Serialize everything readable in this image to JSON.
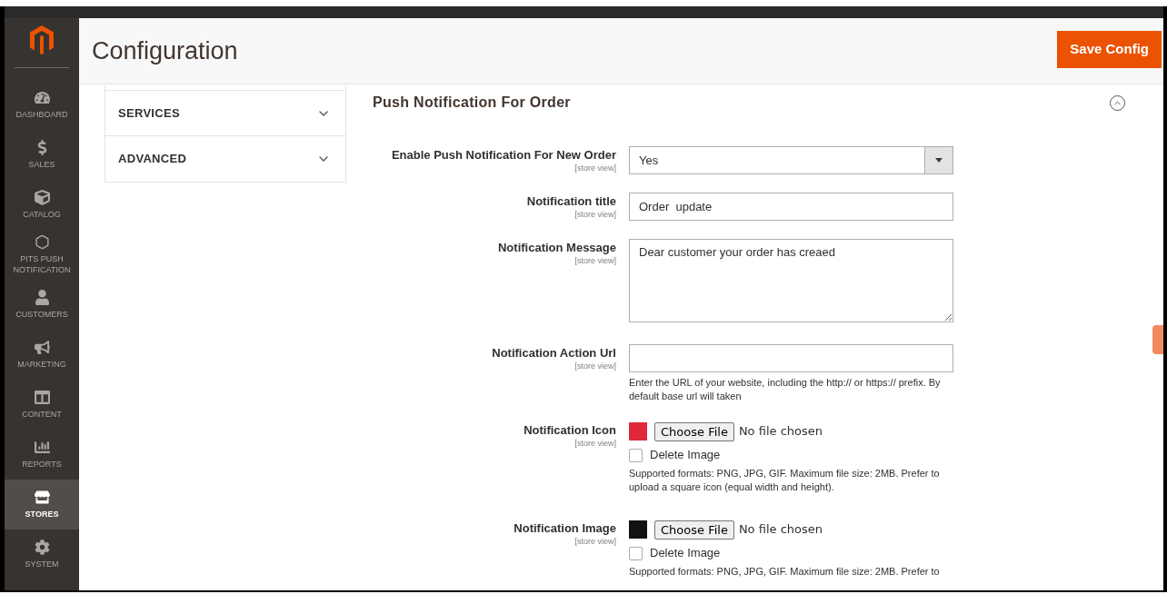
{
  "header": {
    "title": "Configuration",
    "save_button": "Save Config"
  },
  "sidebar": {
    "items": [
      {
        "label": "DASHBOARD",
        "selected": false
      },
      {
        "label": "SALES",
        "selected": false
      },
      {
        "label": "CATALOG",
        "selected": false
      },
      {
        "label": "PITS PUSH NOTIFICATION",
        "selected": false
      },
      {
        "label": "CUSTOMERS",
        "selected": false
      },
      {
        "label": "MARKETING",
        "selected": false
      },
      {
        "label": "CONTENT",
        "selected": false
      },
      {
        "label": "REPORTS",
        "selected": false
      },
      {
        "label": "STORES",
        "selected": true
      },
      {
        "label": "SYSTEM",
        "selected": false
      }
    ]
  },
  "config_tabs": [
    {
      "label": "SERVICES",
      "expanded": false
    },
    {
      "label": "ADVANCED",
      "expanded": false
    }
  ],
  "section": {
    "title": "Push Notification For Order",
    "expanded": true,
    "fields": [
      {
        "kind": "select",
        "label": "Enable Push Notification For New Order",
        "scope": "[store view]",
        "value": "Yes"
      },
      {
        "kind": "text",
        "label": "Notification title",
        "scope": "[store view]",
        "value": "Order  update"
      },
      {
        "kind": "textarea",
        "label": "Notification Message",
        "scope": "[store view]",
        "value": "Dear customer your order has creaed"
      },
      {
        "kind": "text",
        "label": "Notification Action Url",
        "scope": "[store view]",
        "hint": "Enter the URL of your website, including the http:// or https:// prefix. By default base url will taken"
      },
      {
        "kind": "file",
        "label": "Notification Icon",
        "scope": "[store view]",
        "button": "Choose File",
        "status": "No file chosen",
        "delete_label": "Delete Image",
        "delete_checked": false,
        "hint": "Supported formats: PNG, JPG, GIF. Maximum file size: 2MB. Prefer to upload a square icon (equal width and height)."
      },
      {
        "kind": "file",
        "label": "Notification Image",
        "scope": "[store view]",
        "button": "Choose File",
        "status": "No file chosen",
        "delete_label": "Delete Image",
        "delete_checked": false,
        "hint": "Supported formats: PNG, JPG, GIF. Maximum file size: 2MB. Prefer to"
      }
    ]
  }
}
